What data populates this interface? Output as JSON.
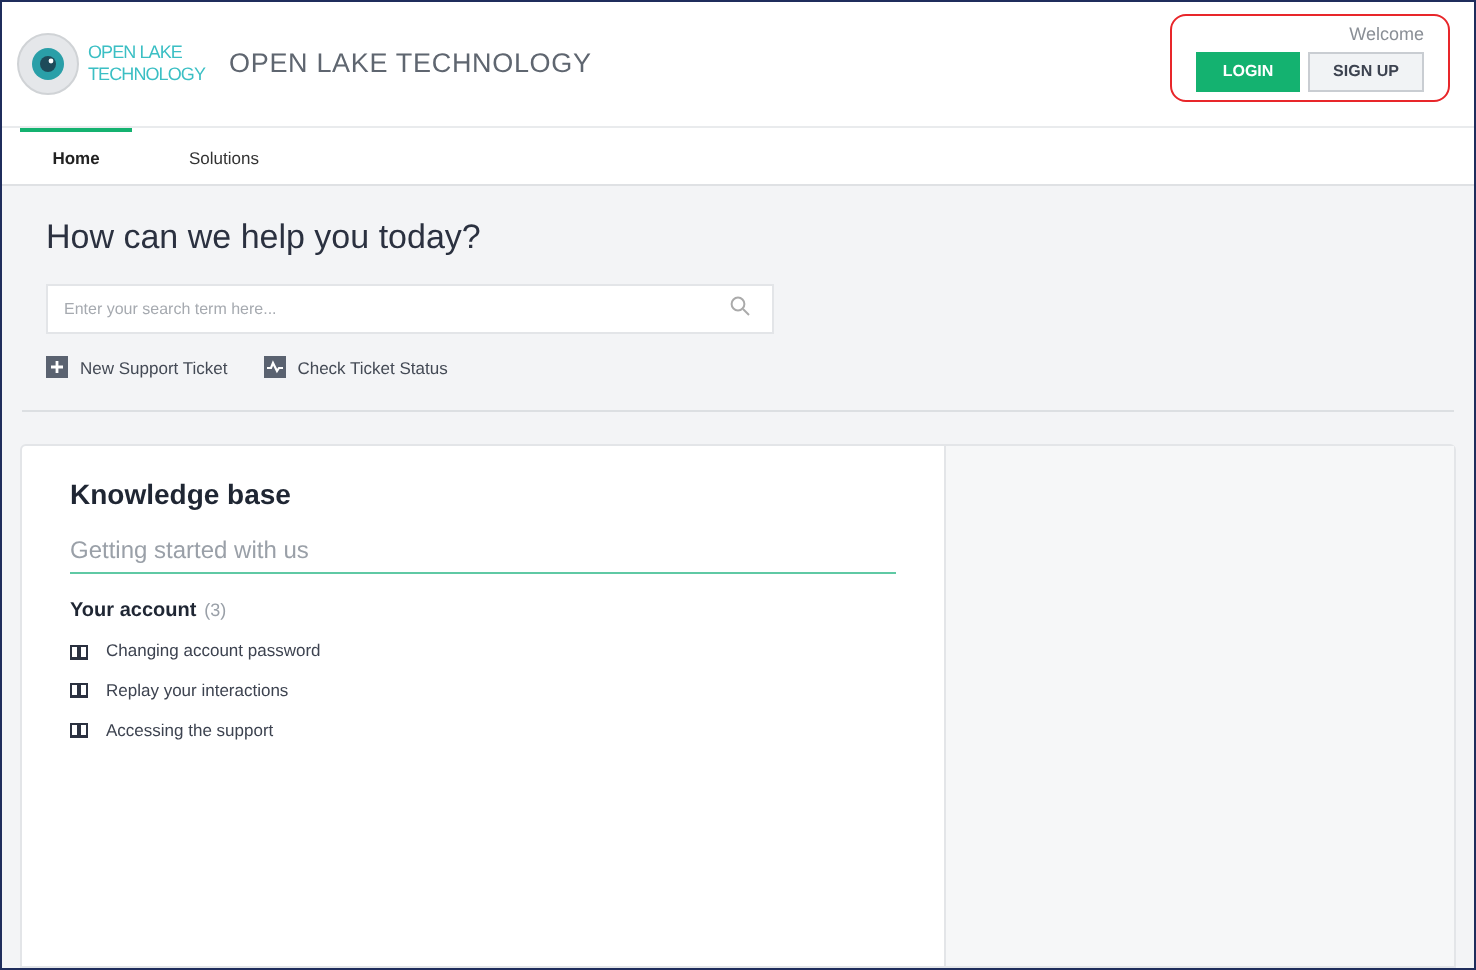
{
  "brand": {
    "logo_text": [
      "OPEN LAKE",
      "TECHNOLOGY"
    ],
    "name": "OPEN LAKE TECHNOLOGY"
  },
  "account": {
    "greeting": "Welcome",
    "buttons": [
      {
        "label": "LOGIN",
        "kind": "primary"
      },
      {
        "label": "SIGN UP",
        "kind": "secondary"
      }
    ]
  },
  "tabs": [
    {
      "label": "Home",
      "selected": true
    },
    {
      "label": "Solutions",
      "selected": false
    }
  ],
  "hero": {
    "title": "How can we help you today?",
    "search": {
      "placeholder": "Enter your search term here..."
    },
    "actions": [
      {
        "label": "New Support Ticket",
        "kind": "new"
      },
      {
        "label": "Check Ticket Status",
        "kind": "status"
      }
    ]
  },
  "knowledge_base": {
    "title": "Knowledge base",
    "section": "Getting started with us",
    "category": {
      "name": "Your account",
      "count": "(3)"
    },
    "articles": [
      "Changing account password",
      "Replay your interactions",
      "Accessing the support"
    ]
  }
}
